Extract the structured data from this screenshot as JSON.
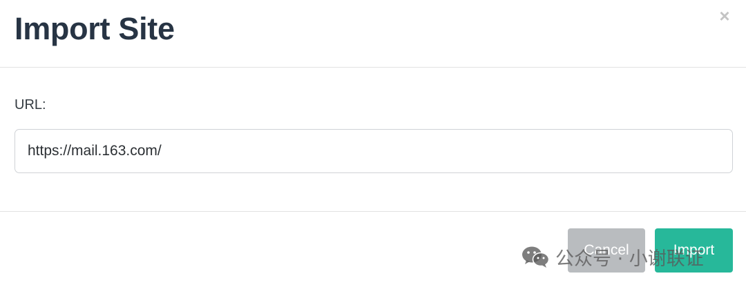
{
  "dialog": {
    "title": "Import Site",
    "close_symbol": "×",
    "close_icon": "close-icon"
  },
  "form": {
    "url_label": "URL:",
    "url_value": "https://mail.163.com/"
  },
  "footer": {
    "cancel_label": "Cancel",
    "import_label": "Import"
  },
  "watermark": {
    "text": "公众号 · 小谢联证",
    "icon": "wechat-logo-icon"
  },
  "colors": {
    "title": "#273444",
    "import_button": "#27b89a",
    "cancel_button": "#b9bcbf",
    "divider": "#e2e2e2",
    "input_border": "#cfd2d6"
  }
}
